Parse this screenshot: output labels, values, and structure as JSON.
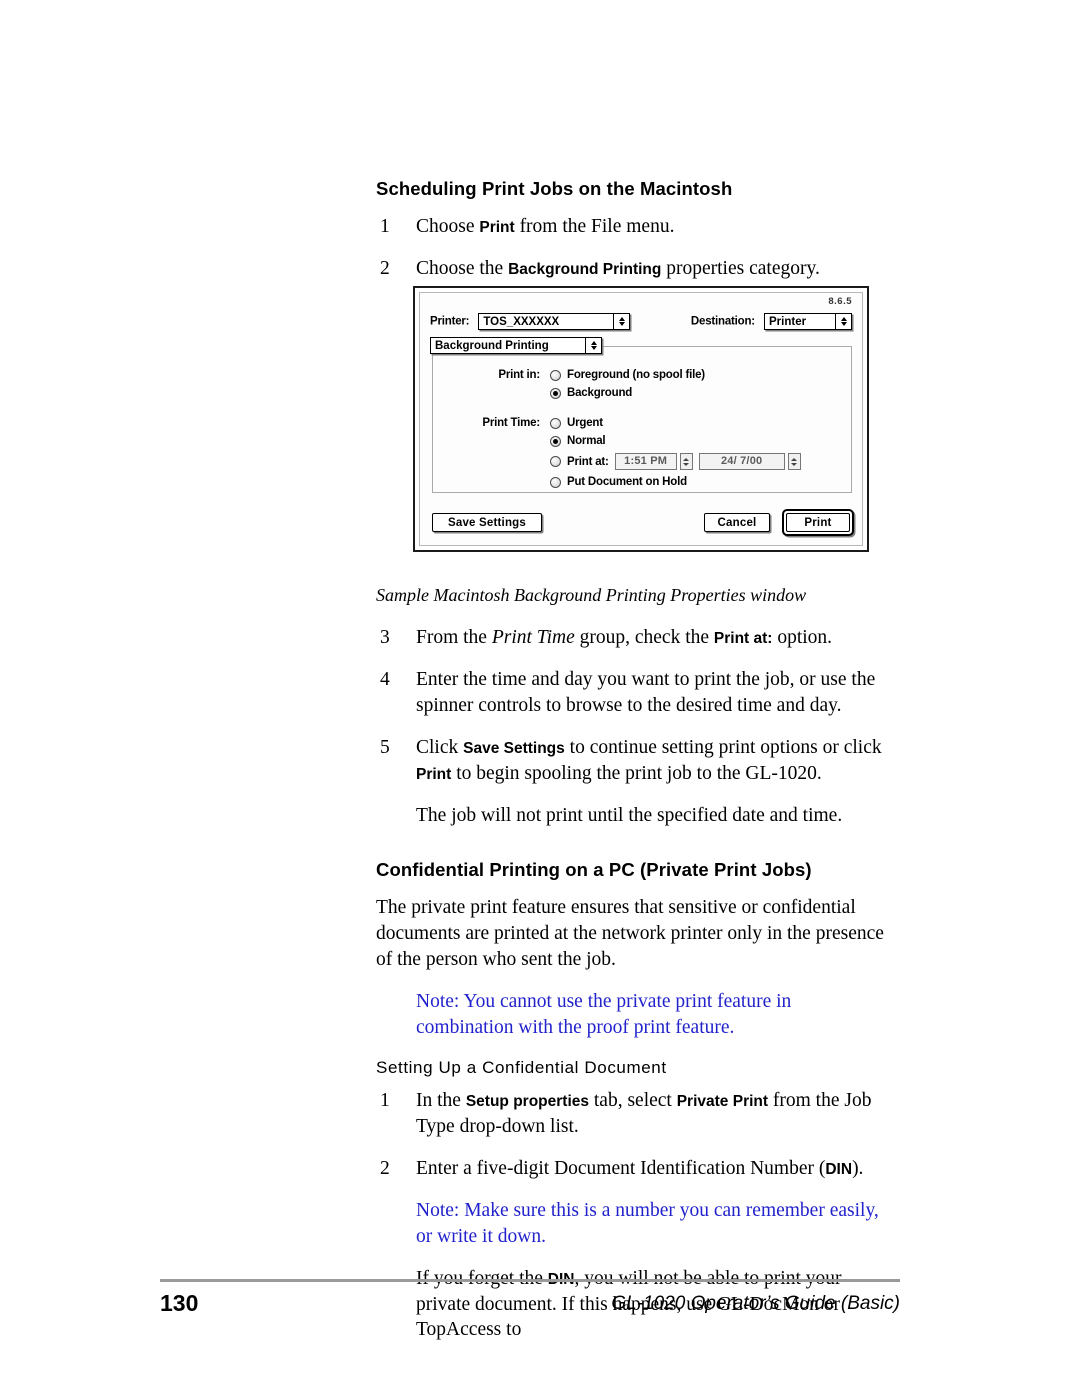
{
  "page": {
    "number": "130",
    "footer_title": "GL-1020 Operator’s Guide (Basic)"
  },
  "section1": {
    "heading": "Scheduling Print Jobs on the Macintosh",
    "step1": {
      "num": "1",
      "pre": "Choose ",
      "ui": "Print",
      "post": " from the File menu."
    },
    "step2": {
      "num": "2",
      "pre": "Choose the ",
      "ui": "Background Printing",
      "post": " properties category."
    },
    "caption": "Sample Macintosh Background Printing Properties window",
    "step3": {
      "num": "3",
      "pre": "From the ",
      "ital": "Print Time",
      "mid": " group, check the ",
      "ui": "Print at:",
      "post": " option."
    },
    "step4": {
      "num": "4",
      "text": "Enter the time and day you want to print the job, or use the spinner controls to browse to the desired time and day."
    },
    "step5": {
      "num": "5",
      "pre": "Click ",
      "ui1": "Save Settings",
      "mid": " to continue setting print options or click ",
      "ui2": "Print",
      "post": " to begin spooling the print job to the GL-1020."
    },
    "after_step5": "The job will not print until the specified date and time."
  },
  "dialog": {
    "os_version": "8.6.5",
    "printer_label": "Printer:",
    "printer_value": "TOS_XXXXXX",
    "destination_label": "Destination:",
    "destination_value": "Printer",
    "category_value": "Background Printing",
    "print_in_label": "Print in:",
    "print_in_options": [
      {
        "label": "Foreground (no spool file)",
        "selected": false
      },
      {
        "label": "Background",
        "selected": true
      }
    ],
    "print_time_label": "Print Time:",
    "print_time_options": [
      {
        "label": "Urgent",
        "selected": false
      },
      {
        "label": "Normal",
        "selected": true
      },
      {
        "label": "Print at:",
        "selected": false
      },
      {
        "label": "Put Document on Hold",
        "selected": false
      }
    ],
    "time_value": "1:51 PM",
    "date_value": "24/ 7/00",
    "save_settings_button": "Save Settings",
    "cancel_button": "Cancel",
    "print_button": "Print"
  },
  "section2": {
    "heading": "Confidential Printing on a PC (Private Print Jobs)",
    "intro": "The private print feature ensures that sensitive or confidential documents are printed at the network printer only in the presence of the person who sent the job.",
    "note1": "Note: You cannot use the private print feature in combination with the proof print feature.",
    "subheading": "Setting Up a Confidential Document",
    "step1": {
      "num": "1",
      "pre": "In the ",
      "ui1": "Setup properties",
      "mid": " tab, select ",
      "ui2": "Private Print",
      "post": " from the Job Type drop-down list."
    },
    "step2": {
      "num": "2",
      "pre": "Enter a five-digit Document Identification Number (",
      "ui": "DIN",
      "post": ")."
    },
    "note2": "Note: Make sure this is a number you can remember easily, or write it down.",
    "closing": {
      "pre": "If you forget the ",
      "ui": "DIN",
      "post": ", you will not be able to print your private document. If this happens, use GL-DocMon or TopAccess to"
    }
  },
  "colors": {
    "note_blue": "#2222cc",
    "rule_gray": "#9a9a9a"
  }
}
